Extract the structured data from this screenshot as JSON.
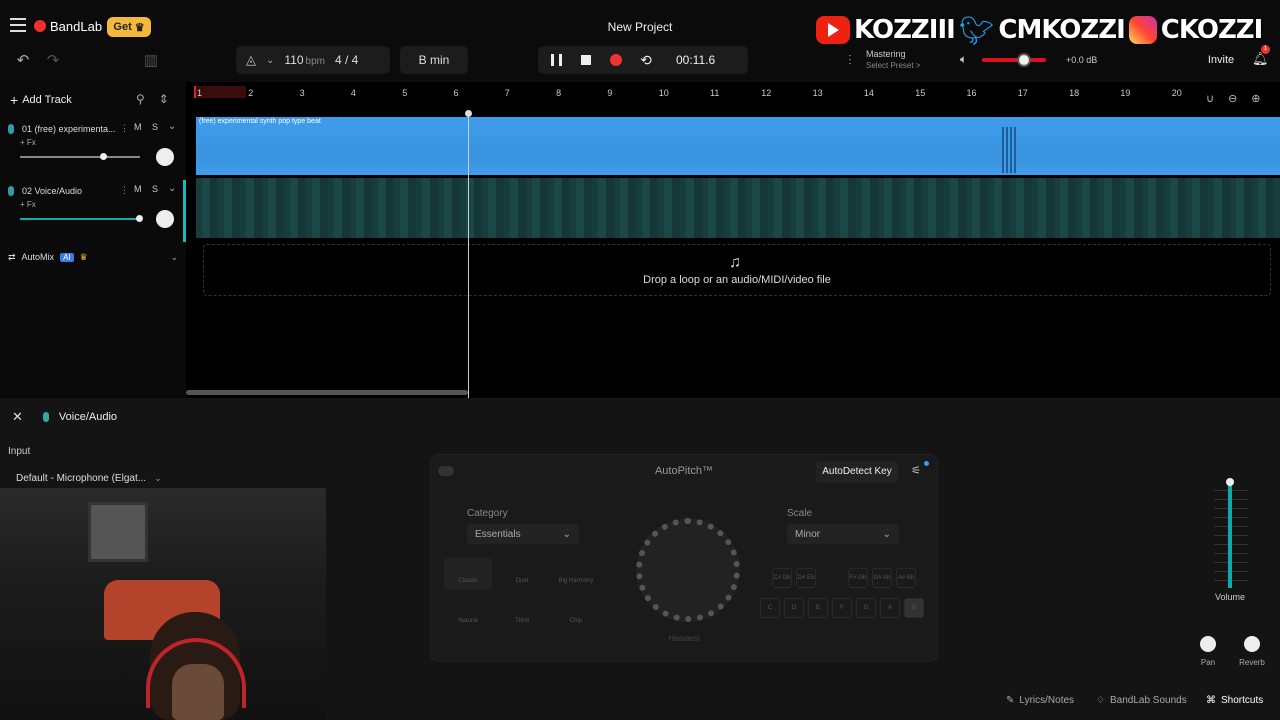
{
  "app": {
    "brand": "BandLab",
    "get_label": "Get",
    "project_title": "New Project"
  },
  "transport": {
    "tempo": "110",
    "tempo_unit": "bpm",
    "time_signature": "4 / 4",
    "key": "B min",
    "time": "00:11.6"
  },
  "mastering": {
    "label": "Mastering",
    "preset": "Select Preset >"
  },
  "master_volume": {
    "db": "+0.0 dB"
  },
  "header": {
    "invite": "Invite",
    "notifications": "1"
  },
  "overlay": {
    "youtube": "KOZZIII",
    "twitter": "CMKOZZI",
    "instagram": "CKOZZI"
  },
  "tracks_panel": {
    "add_track": "Add Track",
    "tracks": [
      {
        "name": "01 (free) experimenta...",
        "fx": "+ Fx",
        "m": "M",
        "s": "S",
        "volume": 0.6
      },
      {
        "name": "02 Voice/Audio",
        "fx": "+ Fx",
        "m": "M",
        "s": "S",
        "volume": 0.9
      }
    ],
    "automix": "AutoMix",
    "automix_badge": "AI"
  },
  "timeline": {
    "bars": [
      "1",
      "2",
      "3",
      "4",
      "5",
      "6",
      "7",
      "8",
      "9",
      "10",
      "11",
      "12",
      "13",
      "14",
      "15",
      "16",
      "17",
      "18",
      "19",
      "20"
    ],
    "region_title": "(free) experimental synth pop type beat",
    "drop_text": "Drop a loop or an audio/MIDI/video file"
  },
  "editor": {
    "track_name": "Voice/Audio",
    "input_label": "Input",
    "input_value": "Default - Microphone (Elgat...",
    "autopitch": {
      "title": "AutoPitch™",
      "autodetect": "AutoDetect Key",
      "category_label": "Category",
      "category_value": "Essentials",
      "scale_label": "Scale",
      "scale_value": "Minor",
      "knob_label": "Heaviest",
      "presets": [
        "Classic",
        "Duet",
        "Big Harmony",
        "Natural",
        "Third",
        "Chip"
      ],
      "notes_top": [
        "C#\nDb",
        "D#\nEb",
        "F#\nGb",
        "G#\nAb",
        "A#\nBb"
      ],
      "notes_bottom": [
        "C",
        "D",
        "E",
        "F",
        "G",
        "A",
        "B"
      ]
    },
    "volume_label": "Volume",
    "pan_label": "Pan",
    "reverb_label": "Reverb"
  },
  "footer": {
    "lyrics": "Lyrics/Notes",
    "sounds": "BandLab Sounds",
    "shortcuts": "Shortcuts"
  }
}
